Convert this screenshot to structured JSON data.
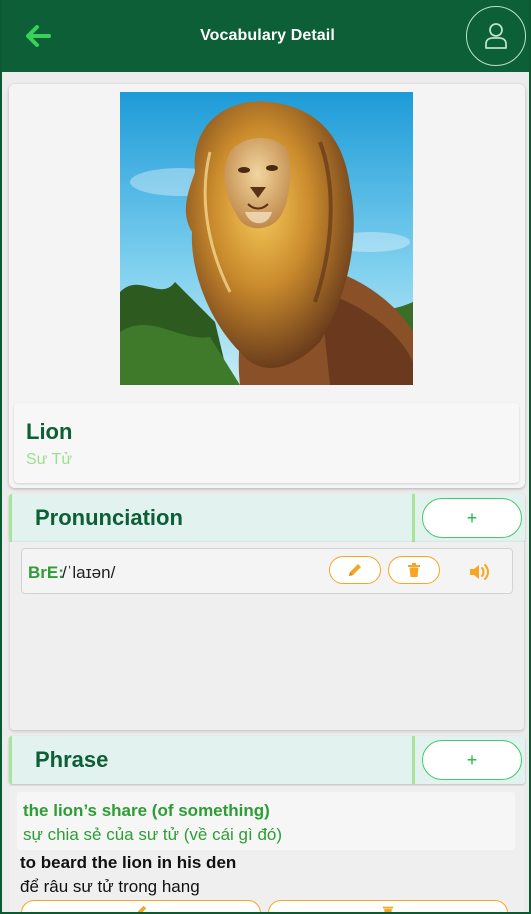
{
  "header": {
    "title": "Vocabulary Detail",
    "back_icon": "arrow-left-icon",
    "profile_icon": "user-icon"
  },
  "word": {
    "english": "Lion",
    "vietnamese": "Sư Tử",
    "image_icon": "lion-illustration"
  },
  "pronunciation": {
    "section_title": "Pronunciation",
    "add_label": "+",
    "items": [
      {
        "accent": "BrE:",
        "ipa": "/ˈlaɪən/"
      }
    ]
  },
  "phrase": {
    "section_title": "Phrase",
    "add_label": "+",
    "items": [
      {
        "english": "the lion’s share (of something)",
        "vietnamese": "sự chia sẻ của sư tử (về cái gì đó)"
      },
      {
        "english": "to beard the lion in his den",
        "vietnamese": "để râu sư tử trong hang"
      }
    ]
  },
  "colors": {
    "primary": "#0c5f36",
    "accent_green": "#2e9d36",
    "orange": "#f5a623",
    "section_bg": "#e2f2ef"
  }
}
